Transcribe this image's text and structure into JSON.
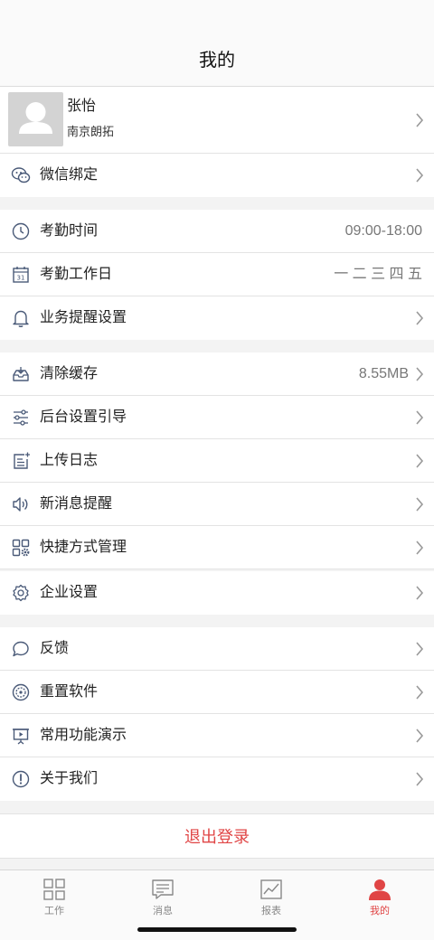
{
  "header": {
    "title": "我的"
  },
  "profile": {
    "name": "张怡",
    "company": "南京朗拓"
  },
  "wechat": {
    "label": "微信绑定"
  },
  "attendance": {
    "time_label": "考勤时间",
    "time_value": "09:00-18:00",
    "workday_label": "考勤工作日",
    "workday_value": "一 二 三 四 五",
    "reminder_label": "业务提醒设置"
  },
  "settings": {
    "clear_cache_label": "清除缓存",
    "clear_cache_value": "8.55MB",
    "background_guide_label": "后台设置引导",
    "upload_log_label": "上传日志",
    "new_message_label": "新消息提醒",
    "shortcut_label": "快捷方式管理",
    "enterprise_label": "企业设置"
  },
  "misc": {
    "feedback_label": "反馈",
    "reset_label": "重置软件",
    "demo_label": "常用功能演示",
    "about_label": "关于我们"
  },
  "logout": {
    "label": "退出登录"
  },
  "tabs": [
    {
      "label": "工作",
      "icon": "grid-icon"
    },
    {
      "label": "消息",
      "icon": "message-icon"
    },
    {
      "label": "报表",
      "icon": "chart-icon"
    },
    {
      "label": "我的",
      "icon": "person-icon",
      "active": true
    }
  ],
  "colors": {
    "accent": "#e04545",
    "icon": "#4a5a78"
  }
}
